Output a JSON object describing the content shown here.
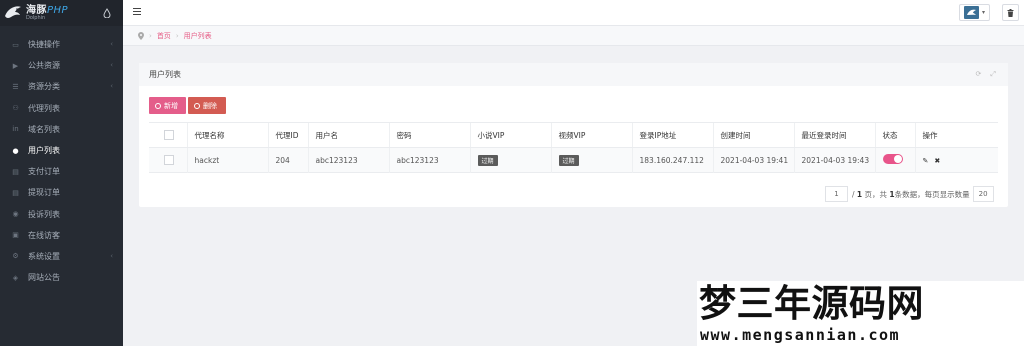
{
  "brand": {
    "name_main": "海豚",
    "name_php": "PHP",
    "sub": "Dolphin"
  },
  "sidebar": {
    "items": [
      {
        "label": "快捷操作",
        "icon": "folder-open-icon",
        "has_caret": true,
        "active": false
      },
      {
        "label": "公共资源",
        "icon": "video-icon",
        "has_caret": true,
        "active": false
      },
      {
        "label": "资源分类",
        "icon": "list-icon",
        "has_caret": true,
        "active": false
      },
      {
        "label": "代理列表",
        "icon": "users-icon",
        "has_caret": false,
        "active": false
      },
      {
        "label": "域名列表",
        "icon": "linkedin-icon",
        "has_caret": false,
        "active": false
      },
      {
        "label": "用户列表",
        "icon": "user-icon",
        "has_caret": false,
        "active": true
      },
      {
        "label": "支付订单",
        "icon": "receipt-icon",
        "has_caret": false,
        "active": false
      },
      {
        "label": "提现订单",
        "icon": "receipt-icon",
        "has_caret": false,
        "active": false
      },
      {
        "label": "投诉列表",
        "icon": "alert-circle-icon",
        "has_caret": false,
        "active": false
      },
      {
        "label": "在线访客",
        "icon": "clipboard-icon",
        "has_caret": false,
        "active": false
      },
      {
        "label": "系统设置",
        "icon": "gear-icon",
        "has_caret": true,
        "active": false
      },
      {
        "label": "网站公告",
        "icon": "megaphone-icon",
        "has_caret": false,
        "active": false
      }
    ]
  },
  "breadcrumb": {
    "home": "首页",
    "current": "用户列表"
  },
  "panel": {
    "title": "用户列表"
  },
  "toolbar": {
    "add_label": "新增",
    "delete_label": "删除"
  },
  "table": {
    "headers": [
      "代理名称",
      "代理ID",
      "用户名",
      "密码",
      "小说VIP",
      "视频VIP",
      "登录IP地址",
      "创建时间",
      "最近登录时间",
      "状态",
      "操作"
    ],
    "rows": [
      {
        "agent_name": "hackzt",
        "agent_id": "204",
        "username": "abc123123",
        "password": "abc123123",
        "novel_vip": "过期",
        "video_vip": "过期",
        "login_ip": "183.160.247.112",
        "created": "2021-04-03 19:41",
        "last_login": "2021-04-03 19:43",
        "status_on": true
      }
    ]
  },
  "pagination": {
    "page": "1",
    "text_total_pages": "/ ",
    "total_pages": "1",
    "text_pages": " 页，共 ",
    "total_count": "1",
    "text_count": " 条数据，每页显示数量",
    "page_size": "20"
  },
  "watermark": {
    "title": "梦三年源码网",
    "url": "www.mengsannian.com"
  },
  "colors": {
    "sidebar_bg": "#262b33",
    "accent": "#e45d8a",
    "danger": "#d35b52"
  }
}
